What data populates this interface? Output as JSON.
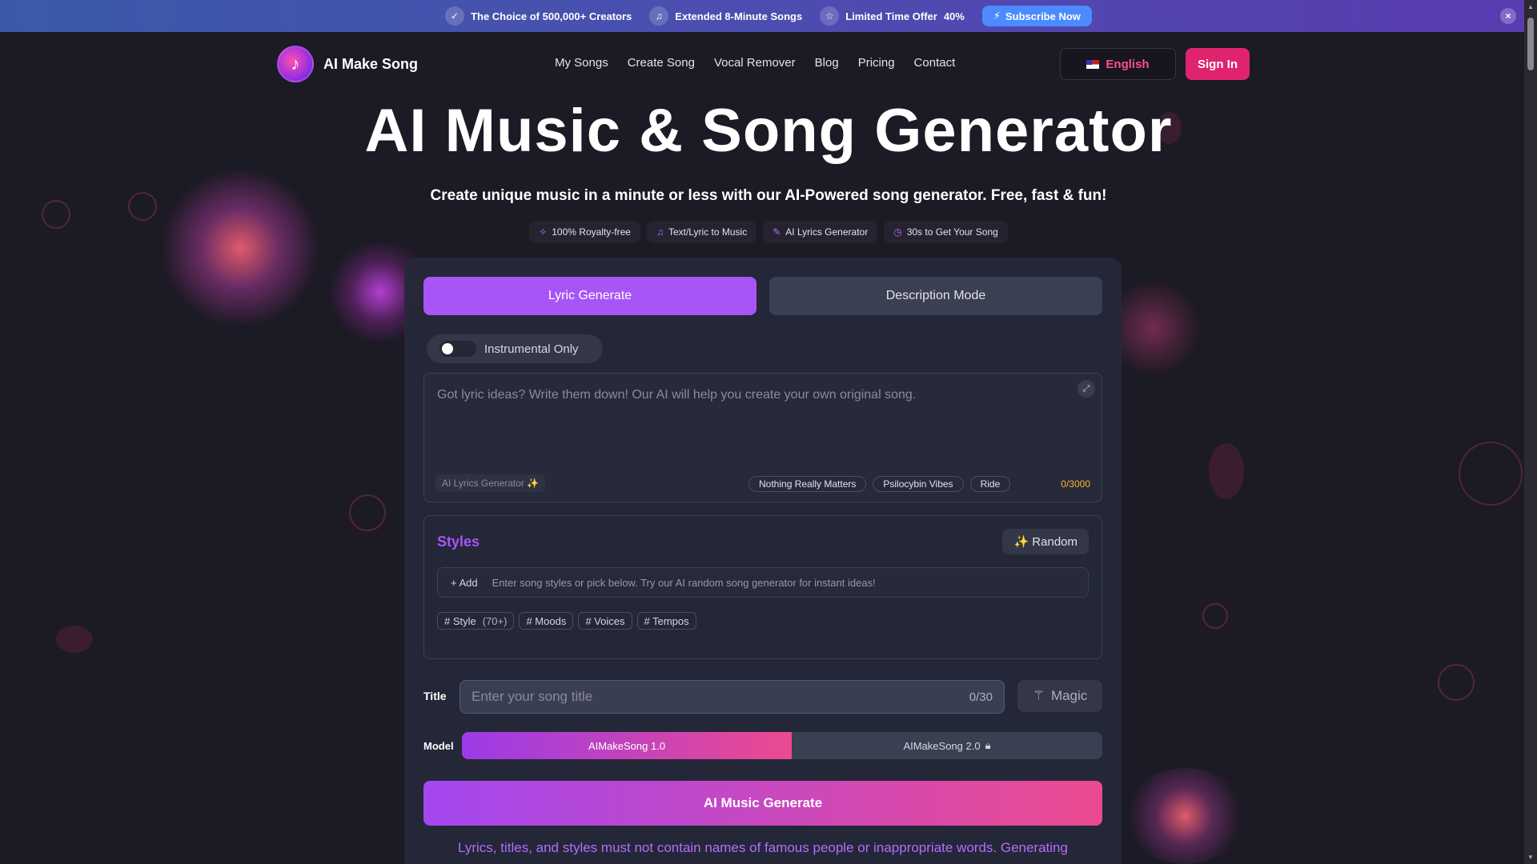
{
  "topbar": {
    "item1": "The Choice of 500,000+ Creators",
    "item2": "Extended 8-Minute Songs",
    "item3_prefix": "Limited Time Offer",
    "item3_bold": "40%",
    "subscribe": "Subscribe Now",
    "close": "×"
  },
  "header": {
    "brand": "AI Make Song",
    "nav": [
      "My Songs",
      "Create Song",
      "Vocal Remover",
      "Blog",
      "Pricing",
      "Contact"
    ],
    "language": "English",
    "signin": "Sign In"
  },
  "hero": {
    "title": "AI Music & Song Generator",
    "subtitle": "Create unique music in a minute or less with our AI-Powered song generator. Free, fast & fun!",
    "badges": [
      "100% Royalty-free",
      "Text/Lyric to Music",
      "AI Lyrics Generator",
      "30s to Get Your Song"
    ]
  },
  "form": {
    "tabs": [
      "Lyric Generate",
      "Description Mode"
    ],
    "instrumental": "Instrumental Only",
    "lyrics_placeholder": "Got lyric ideas? Write them down! Our AI will help you create your own original song.",
    "ai_lyrics_btn": "AI Lyrics Generator ✨",
    "sample_chips": [
      "Nothing Really Matters",
      "Psilocybin Vibes",
      "Ride"
    ],
    "lyrics_counter": "0/3000",
    "styles_title": "Styles",
    "random_btn": "✨ Random",
    "add_label": "+ Add",
    "styles_hint": "Enter song styles or pick below. Try our AI random song generator for instant ideas!",
    "tags": [
      {
        "label": "# Style",
        "count": "(70+)"
      },
      {
        "label": "# Moods",
        "count": ""
      },
      {
        "label": "# Voices",
        "count": ""
      },
      {
        "label": "# Tempos",
        "count": ""
      }
    ],
    "title_label": "Title",
    "title_placeholder": "Enter your song title",
    "title_counter": "0/30",
    "magic_btn": "Magic",
    "model_label": "Model",
    "models": [
      "AIMakeSong 1.0",
      "AIMakeSong 2.0"
    ],
    "generate_btn": "AI Music Generate",
    "notice": "Lyrics, titles, and styles must not contain names of famous people or inappropriate words. Generating"
  },
  "colors": {
    "accent": "#a855f7",
    "pink": "#e0236e",
    "counter": "#f5b82e"
  }
}
